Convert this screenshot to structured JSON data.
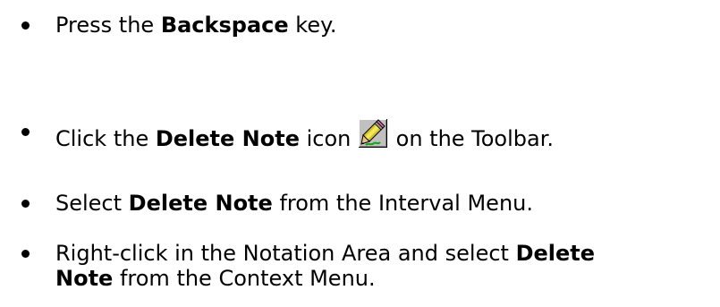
{
  "bullets": [
    {
      "pre": "Press the ",
      "bold": "Backspace",
      "post": " key."
    },
    {
      "pre": "Click the ",
      "bold": "Delete Note",
      "mid": " icon ",
      "icon": "delete-note-pencil-icon",
      "post": " on the Toolbar."
    },
    {
      "pre": "Select ",
      "bold": "Delete Note",
      "post": " from the Interval Menu."
    },
    {
      "pre": "Right-click in the Notation Area and select ",
      "bold": "Delete",
      "bold2": "Note",
      "post": " from the Context Menu."
    }
  ]
}
